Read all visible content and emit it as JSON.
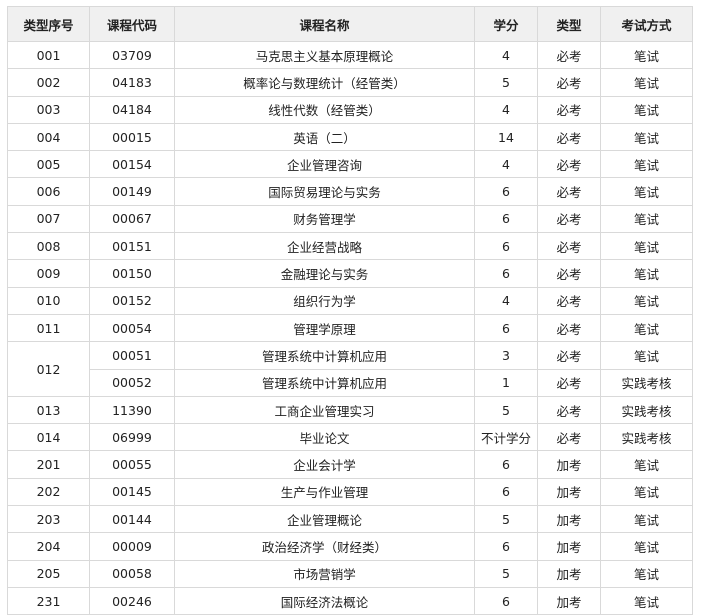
{
  "headers": {
    "seq": "类型序号",
    "code": "课程代码",
    "name": "课程名称",
    "credit": "学分",
    "type": "类型",
    "exam": "考试方式"
  },
  "rows": [
    {
      "seq": "001",
      "code": "03709",
      "name": "马克思主义基本原理概论",
      "credit": "4",
      "type": "必考",
      "exam": "笔试"
    },
    {
      "seq": "002",
      "code": "04183",
      "name": "概率论与数理统计（经管类）",
      "credit": "5",
      "type": "必考",
      "exam": "笔试"
    },
    {
      "seq": "003",
      "code": "04184",
      "name": "线性代数（经管类）",
      "credit": "4",
      "type": "必考",
      "exam": "笔试"
    },
    {
      "seq": "004",
      "code": "00015",
      "name": "英语（二）",
      "credit": "14",
      "type": "必考",
      "exam": "笔试"
    },
    {
      "seq": "005",
      "code": "00154",
      "name": "企业管理咨询",
      "credit": "4",
      "type": "必考",
      "exam": "笔试"
    },
    {
      "seq": "006",
      "code": "00149",
      "name": "国际贸易理论与实务",
      "credit": "6",
      "type": "必考",
      "exam": "笔试"
    },
    {
      "seq": "007",
      "code": "00067",
      "name": "财务管理学",
      "credit": "6",
      "type": "必考",
      "exam": "笔试"
    },
    {
      "seq": "008",
      "code": "00151",
      "name": "企业经营战略",
      "credit": "6",
      "type": "必考",
      "exam": "笔试"
    },
    {
      "seq": "009",
      "code": "00150",
      "name": "金融理论与实务",
      "credit": "6",
      "type": "必考",
      "exam": "笔试"
    },
    {
      "seq": "010",
      "code": "00152",
      "name": "组织行为学",
      "credit": "4",
      "type": "必考",
      "exam": "笔试"
    },
    {
      "seq": "011",
      "code": "00054",
      "name": "管理学原理",
      "credit": "6",
      "type": "必考",
      "exam": "笔试"
    },
    {
      "seq": "012",
      "code": "00051",
      "name": "管理系统中计算机应用",
      "credit": "3",
      "type": "必考",
      "exam": "笔试"
    },
    {
      "seq": "",
      "code": "00052",
      "name": "管理系统中计算机应用",
      "credit": "1",
      "type": "必考",
      "exam": "实践考核"
    },
    {
      "seq": "013",
      "code": "11390",
      "name": "工商企业管理实习",
      "credit": "5",
      "type": "必考",
      "exam": "实践考核"
    },
    {
      "seq": "014",
      "code": "06999",
      "name": "毕业论文",
      "credit": "不计学分",
      "type": "必考",
      "exam": "实践考核"
    },
    {
      "seq": "201",
      "code": "00055",
      "name": "企业会计学",
      "credit": "6",
      "type": "加考",
      "exam": "笔试"
    },
    {
      "seq": "202",
      "code": "00145",
      "name": "生产与作业管理",
      "credit": "6",
      "type": "加考",
      "exam": "笔试"
    },
    {
      "seq": "203",
      "code": "00144",
      "name": "企业管理概论",
      "credit": "5",
      "type": "加考",
      "exam": "笔试"
    },
    {
      "seq": "204",
      "code": "00009",
      "name": "政治经济学（财经类）",
      "credit": "6",
      "type": "加考",
      "exam": "笔试"
    },
    {
      "seq": "205",
      "code": "00058",
      "name": "市场营销学",
      "credit": "5",
      "type": "加考",
      "exam": "笔试"
    },
    {
      "seq": "231",
      "code": "00246",
      "name": "国际经济法概论",
      "credit": "6",
      "type": "加考",
      "exam": "笔试"
    }
  ]
}
